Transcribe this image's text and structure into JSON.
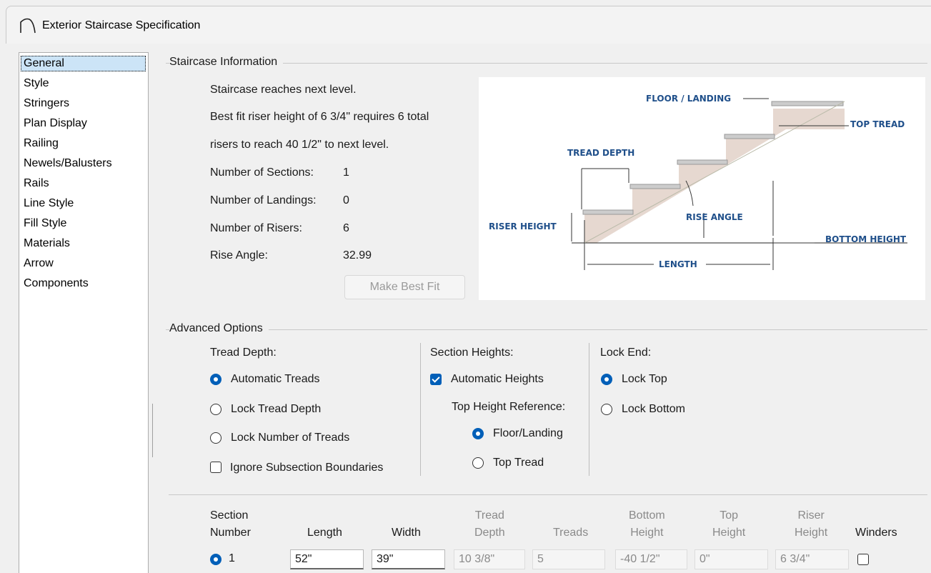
{
  "window": {
    "title": "Exterior Staircase Specification"
  },
  "sidebar": {
    "items": [
      {
        "label": "General",
        "selected": true
      },
      {
        "label": "Style"
      },
      {
        "label": "Stringers"
      },
      {
        "label": "Plan Display"
      },
      {
        "label": "Railing"
      },
      {
        "label": "Newels/Balusters"
      },
      {
        "label": "Rails"
      },
      {
        "label": "Line Style"
      },
      {
        "label": "Fill Style"
      },
      {
        "label": "Materials"
      },
      {
        "label": "Arrow"
      },
      {
        "label": "Components"
      }
    ]
  },
  "info": {
    "title": "Staircase Information",
    "line1": "Staircase reaches next level.",
    "line2": "Best fit riser height of 6 3/4\" requires 6 total",
    "line3": "risers to reach 40 1/2\" to next level.",
    "sections_label": "Number of Sections:",
    "sections_value": "1",
    "landings_label": "Number of Landings:",
    "landings_value": "0",
    "risers_label": "Number of Risers:",
    "risers_value": "6",
    "angle_label": "Rise Angle:",
    "angle_value": "32.99",
    "best_fit_button": "Make Best Fit"
  },
  "diagram": {
    "floor_landing": "FLOOR / LANDING",
    "top_tread": "TOP TREAD",
    "tread_depth": "TREAD DEPTH",
    "rise_angle": "RISE ANGLE",
    "riser_height": "RISER HEIGHT",
    "bottom_height": "BOTTOM HEIGHT",
    "length": "LENGTH"
  },
  "advanced": {
    "title": "Advanced Options",
    "tread_depth_label": "Tread Depth:",
    "automatic_treads": "Automatic Treads",
    "lock_tread_depth": "Lock Tread Depth",
    "lock_number_treads": "Lock Number of Treads",
    "ignore_subsection": "Ignore Subsection Boundaries",
    "section_heights_label": "Section Heights:",
    "automatic_heights": "Automatic Heights",
    "top_height_ref_label": "Top Height Reference:",
    "floor_landing": "Floor/Landing",
    "top_tread": "Top Tread",
    "lock_end_label": "Lock End:",
    "lock_top": "Lock Top",
    "lock_bottom": "Lock Bottom"
  },
  "table": {
    "headers": {
      "section_number": [
        "Section",
        "Number"
      ],
      "length": "Length",
      "width": "Width",
      "tread_depth": [
        "Tread",
        "Depth"
      ],
      "treads": "Treads",
      "bottom_height": [
        "Bottom",
        "Height"
      ],
      "top_height": [
        "Top",
        "Height"
      ],
      "riser_height": [
        "Riser",
        "Height"
      ],
      "winders": "Winders"
    },
    "row": {
      "number": "1",
      "length": "52\"",
      "width": "39\"",
      "tread_depth": "10 3/8\"",
      "treads": "5",
      "bottom_height": "-40 1/2\"",
      "top_height": "0\"",
      "riser_height": "6 3/4\""
    }
  }
}
